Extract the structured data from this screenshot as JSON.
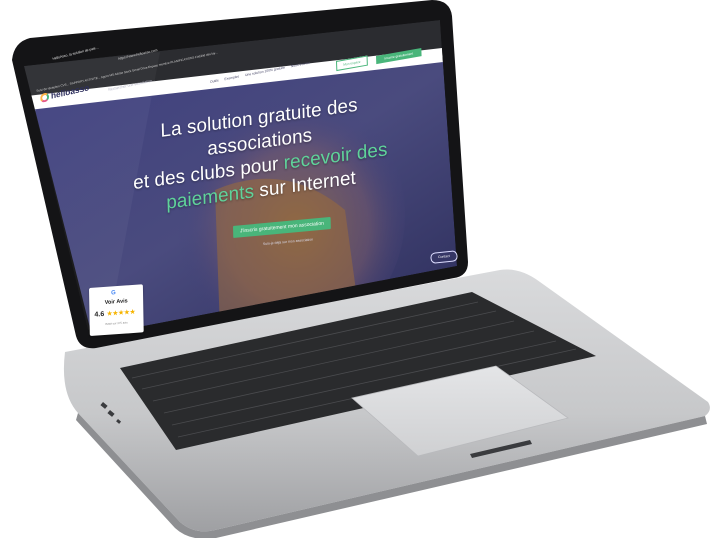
{
  "browser": {
    "tab_title": "HelloAsso, la solution de paie...",
    "url": "https://www.helloasso.com",
    "bookmarks": "Suivi de réception CVS...  RAPPORT ACTIVITE...  Agora  MS  Adobe Stock  Gmail  Drive  Espace membre  PLANIFICATIONS  Fiabilité des lay..."
  },
  "site": {
    "logo_text": "helloasso",
    "search_placeholder": "Rechercher une association...",
    "nav": [
      "Outils",
      "Exemples",
      "Une solution 100% gratuite",
      "Nous trouver"
    ],
    "login_button": "Mon espace",
    "signup_button": "Inscrire gratuitement"
  },
  "hero": {
    "line1": "La solution gratuite des associations",
    "line2_a": "et des clubs pour ",
    "line2_b": "recevoir des",
    "line3_a": "paiements",
    "line3_b": " sur Internet",
    "cta": "J'inscris gratuitement mon association",
    "subcta": "Suis-je déjà sur mon association"
  },
  "review_badge": {
    "google": "G",
    "title": "Voir Avis",
    "score": "4.6",
    "stars": "★★★★★",
    "base": "Basé sur 375 avis"
  },
  "chat_button": "Contact",
  "colors": {
    "brand_green": "#49b57a",
    "brand_navy": "#2e2f5e",
    "hero_overlay": "#3b3c78"
  }
}
